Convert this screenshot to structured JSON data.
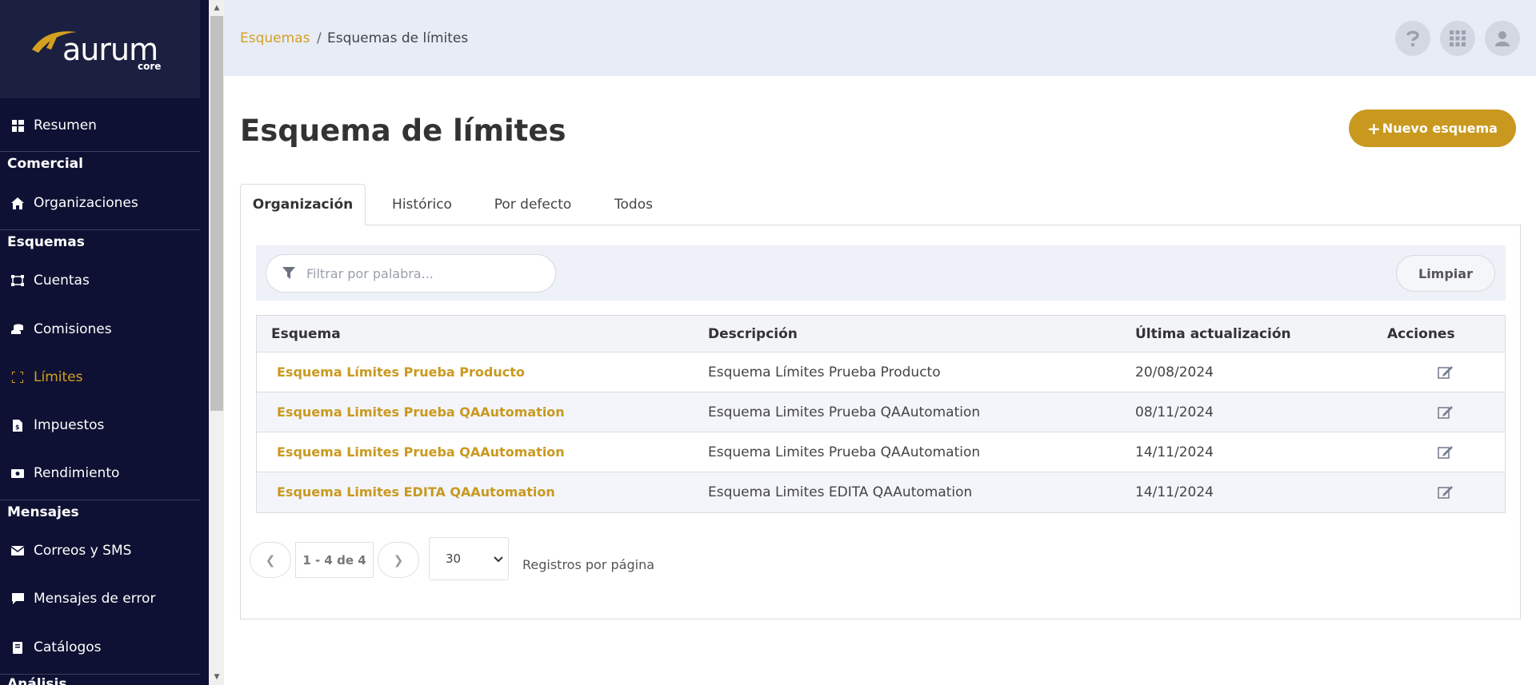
{
  "brand": {
    "name": "aurum",
    "sub": "core"
  },
  "sidebar": {
    "items": [
      {
        "label": "Resumen"
      },
      {
        "label": "Organizaciones"
      },
      {
        "label": "Cuentas"
      },
      {
        "label": "Comisiones"
      },
      {
        "label": "Límites"
      },
      {
        "label": "Impuestos"
      },
      {
        "label": "Rendimiento"
      },
      {
        "label": "Correos y SMS"
      },
      {
        "label": "Mensajes de error"
      },
      {
        "label": "Catálogos"
      }
    ],
    "sections": [
      "Comercial",
      "Esquemas",
      "Mensajes",
      "Análisis"
    ]
  },
  "breadcrumb": {
    "link": "Esquemas",
    "separator": "/",
    "current": "Esquemas de límites"
  },
  "header": {
    "help_icon": "question-icon",
    "apps_icon": "grid-icon",
    "user_icon": "user-icon"
  },
  "page": {
    "title": "Esquema de límites",
    "new_button": "Nuevo esquema"
  },
  "tabs": [
    {
      "label": "Organización"
    },
    {
      "label": "Histórico"
    },
    {
      "label": "Por defecto"
    },
    {
      "label": "Todos"
    }
  ],
  "filter": {
    "placeholder": "Filtrar por palabra...",
    "clear_label": "Limpiar"
  },
  "table": {
    "columns": [
      "Esquema",
      "Descripción",
      "Última actualización",
      "Acciones"
    ],
    "rows": [
      {
        "name": "Esquema Límites Prueba Producto",
        "description": "Esquema Límites Prueba Producto",
        "updated": "20/08/2024"
      },
      {
        "name": "Esquema Limites Prueba QAAutomation",
        "description": "Esquema Limites Prueba QAAutomation",
        "updated": "08/11/2024"
      },
      {
        "name": "Esquema Limites Prueba QAAutomation",
        "description": "Esquema Limites Prueba QAAutomation",
        "updated": "14/11/2024"
      },
      {
        "name": "Esquema Limites EDITA QAAutomation",
        "description": "Esquema Limites EDITA QAAutomation",
        "updated": "14/11/2024"
      }
    ]
  },
  "pagination": {
    "info": "1 - 4 de 4",
    "page_size": "30",
    "page_size_label": "Registros por página"
  },
  "colors": {
    "accent": "#c9991f",
    "sidebar_bg": "#0e1133",
    "header_bg": "#e7ecf7"
  }
}
